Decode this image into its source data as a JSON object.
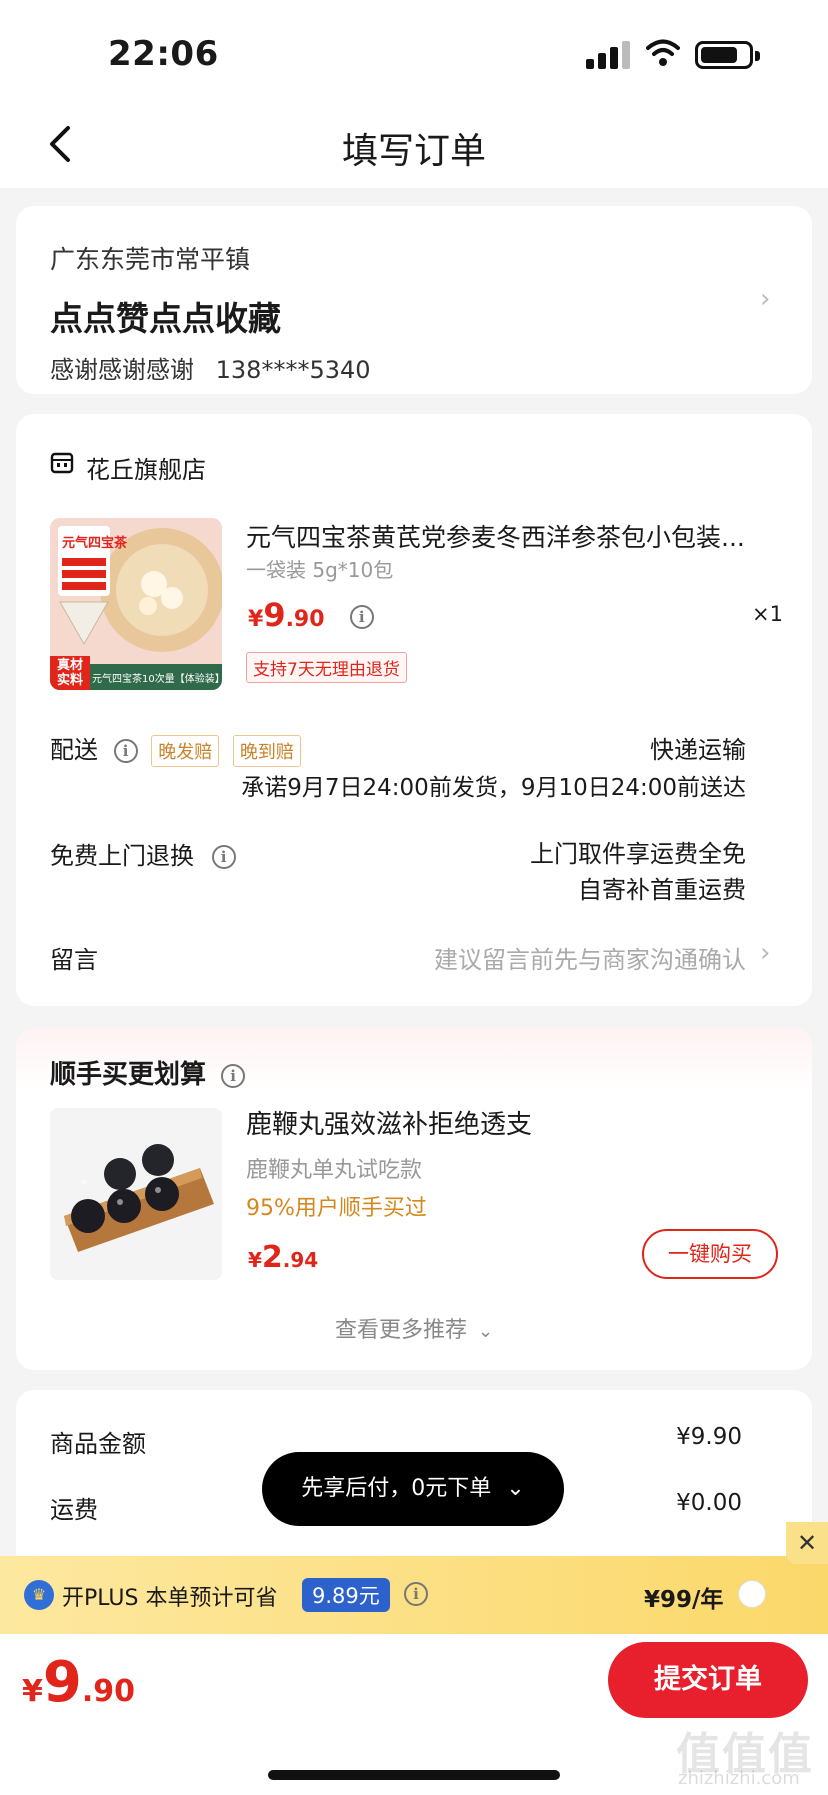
{
  "status_bar": {
    "time": "22:06"
  },
  "nav": {
    "title": "填写订单"
  },
  "address": {
    "region": "广东东莞市常平镇",
    "detail": "点点赞点点收藏",
    "name": "感谢感谢感谢",
    "phone": "138****5340"
  },
  "store": {
    "name": "花丘旗舰店"
  },
  "product": {
    "title": "元气四宝茶黄芪党参麦冬西洋参茶包小包装...",
    "spec": "一袋装 5g*10包",
    "price_symbol": "¥",
    "price_int": "9",
    "price_dec": ".90",
    "qty": "×1",
    "return_tag": "支持7天无理由退货",
    "image_label": "元气四宝茶",
    "image_caption": "元气四宝茶10次量【体验装】",
    "image_badge": "真材实料"
  },
  "delivery": {
    "label": "配送",
    "tag1": "晚发赔",
    "tag2": "晚到赔",
    "method": "快递运输",
    "promise": "承诺9月7日24:00前发货，9月10日24:00前送达"
  },
  "return_service": {
    "label": "免费上门退换",
    "line1": "上门取件享运费全免",
    "line2": "自寄补首重运费"
  },
  "message": {
    "label": "留言",
    "placeholder": "建议留言前先与商家沟通确认"
  },
  "recommend": {
    "title": "顺手买更划算",
    "name": "鹿鞭丸强效滋补拒绝透支",
    "sub": "鹿鞭丸单丸试吃款",
    "percent": "95%用户顺手买过",
    "price_symbol": "¥",
    "price_int": "2",
    "price_dec": ".94",
    "buy_label": "一键购买",
    "more_label": "查看更多推荐"
  },
  "amount": {
    "goods_label": "商品金额",
    "goods_value": "¥9.90",
    "shipping_label": "运费",
    "shipping_value": "¥0.00"
  },
  "pay_later": {
    "label": "先享后付，0元下单"
  },
  "plus": {
    "text": "开PLUS 本单预计可省",
    "save": "9.89元",
    "price": "¥99/年"
  },
  "footer": {
    "total_symbol": "¥",
    "total_int": "9",
    "total_dec": ".90",
    "submit_label": "提交订单"
  },
  "watermark": {
    "main": "值值值",
    "sub": "zhizhizhi.com"
  },
  "colors": {
    "accent": "#e1251b",
    "gold": "#c9842b",
    "plus_blue": "#2d62cc"
  }
}
